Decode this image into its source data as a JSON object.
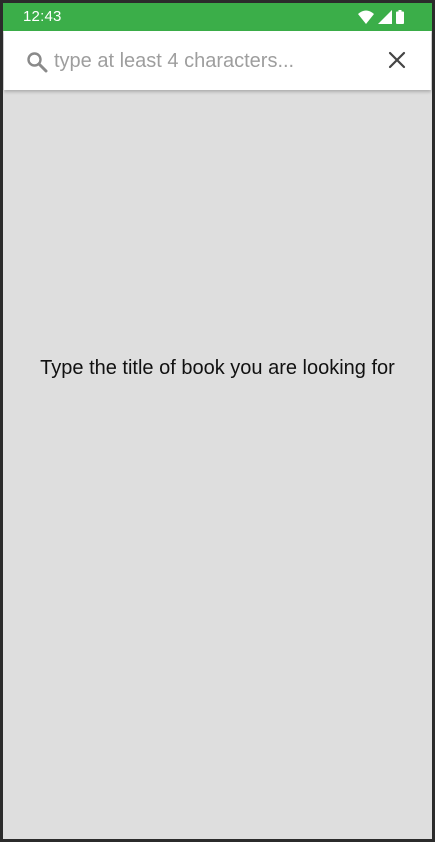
{
  "status_bar": {
    "time": "12:43",
    "icons": [
      "wifi-icon",
      "signal-icon",
      "battery-icon"
    ],
    "color": "#3bae49"
  },
  "search": {
    "placeholder": "type at least 4 characters...",
    "value": "",
    "leading_icon": "search-icon",
    "clear_icon": "close-icon"
  },
  "main": {
    "empty_message": "Type the title of book you are looking for",
    "background": "#dedede"
  }
}
